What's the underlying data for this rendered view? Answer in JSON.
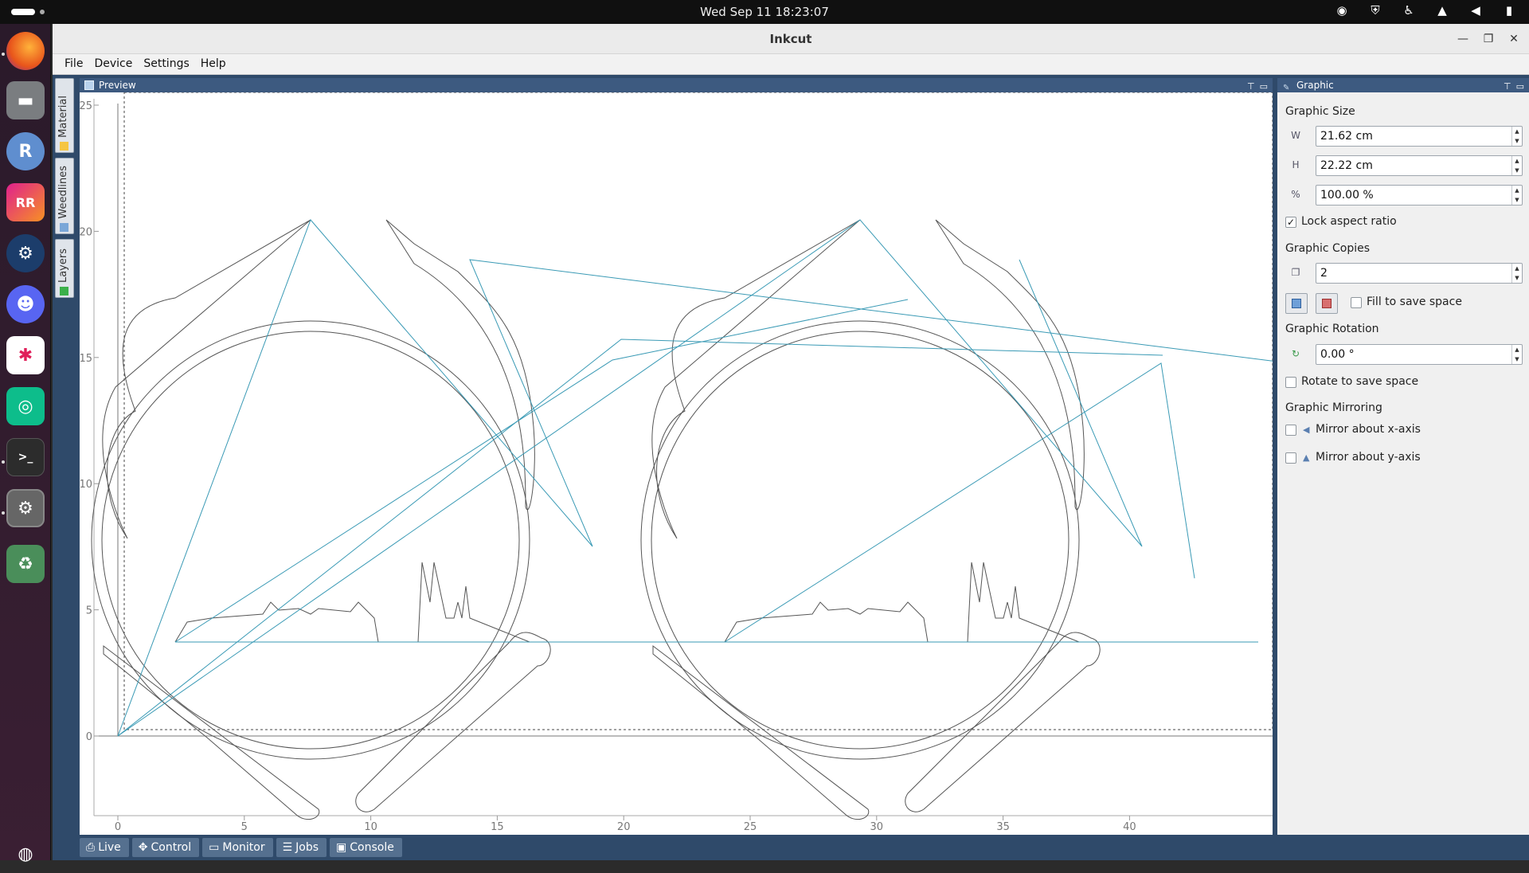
{
  "topbar": {
    "clock": "Wed Sep 11  18:23:07",
    "tray_icons": [
      "discord-tray-icon",
      "shield-tray-icon",
      "accessibility-icon",
      "wifi-icon",
      "volume-icon",
      "battery-icon"
    ]
  },
  "dock": {
    "apps": [
      "firefox",
      "files",
      "r-studio",
      "rustrover",
      "steam",
      "discord",
      "slack",
      "element",
      "terminal",
      "settings",
      "trash",
      "show-apps"
    ]
  },
  "window": {
    "title": "Inkcut",
    "menu": [
      "File",
      "Device",
      "Settings",
      "Help"
    ]
  },
  "side_tabs": [
    "Material",
    "Weedlines",
    "Layers"
  ],
  "preview": {
    "title": "Preview"
  },
  "plot_axes": {
    "x_ticks": [
      "0",
      "5",
      "10",
      "15",
      "20",
      "25",
      "30",
      "35",
      "40"
    ],
    "y_ticks": [
      "0",
      "5",
      "10",
      "15",
      "20",
      "25"
    ]
  },
  "graphic_panel": {
    "title": "Graphic",
    "size_label": "Graphic Size",
    "width_value": "21.62 cm",
    "height_value": "22.22 cm",
    "scale_value": "100.00 %",
    "lock_aspect_label": "Lock aspect ratio",
    "lock_aspect_checked": true,
    "copies_label": "Graphic Copies",
    "copies_value": "2",
    "fill_label": "Fill to save space",
    "fill_checked": false,
    "rotation_label": "Graphic Rotation",
    "rotation_value": "0.00 °",
    "rotate_save_label": "Rotate to save space",
    "rotate_save_checked": false,
    "mirroring_label": "Graphic Mirroring",
    "mirror_x_label": "Mirror about x-axis",
    "mirror_y_label": "Mirror about y-axis"
  },
  "bottom_tabs": [
    "Live",
    "Control",
    "Monitor",
    "Jobs",
    "Console"
  ]
}
